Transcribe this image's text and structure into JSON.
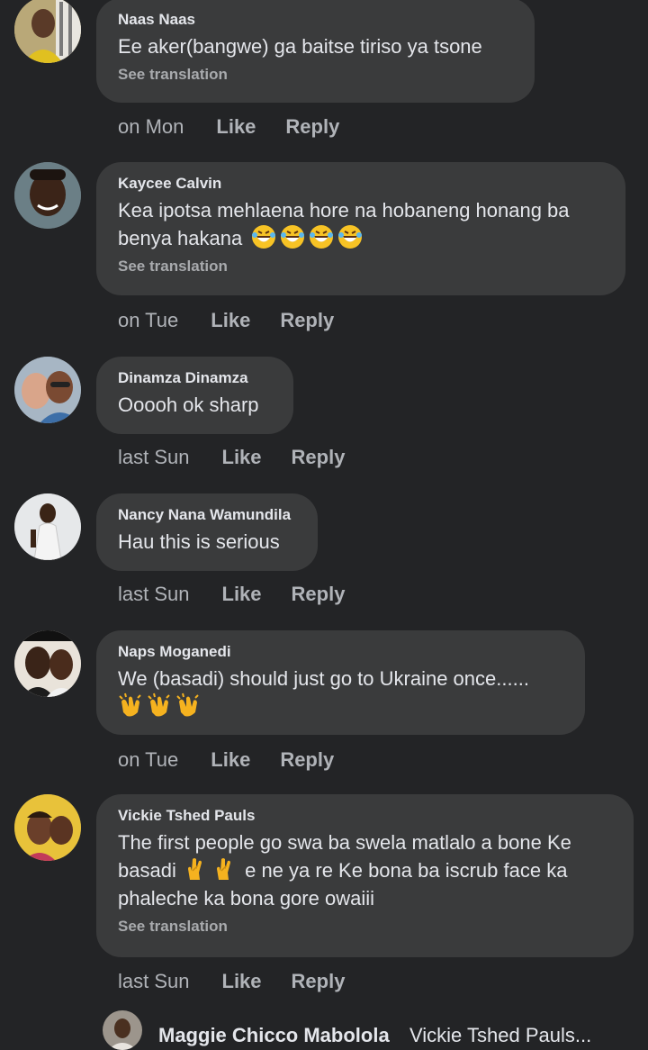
{
  "comments": [
    {
      "author": "Naas Naas",
      "text": "Ee aker(bangwe) ga baitse tiriso ya tsone",
      "see_translation": "See translation",
      "time": "on Mon",
      "like": "Like",
      "reply": "Reply"
    },
    {
      "author": "Kaycee Calvin",
      "text_line1": "Kea ipotsa mehlaena hore na hobaneng honang ba",
      "text_line2": "benya hakana",
      "emoji": "laughing-crying-emoji x4",
      "see_translation": "See translation",
      "time": "on Tue",
      "like": "Like",
      "reply": "Reply"
    },
    {
      "author": "Dinamza Dinamza",
      "text": "Ooooh ok sharp",
      "time": "last Sun",
      "like": "Like",
      "reply": "Reply"
    },
    {
      "author": "Nancy Nana Wamundila",
      "text": "Hau this is serious",
      "time": "last Sun",
      "like": "Like",
      "reply": "Reply"
    },
    {
      "author": "Naps Moganedi",
      "text": "We (basadi) should just go to Ukraine once......",
      "emoji": "clapping-hands-emoji x3",
      "time": "on Tue",
      "like": "Like",
      "reply": "Reply"
    },
    {
      "author": "Vickie Tshed Pauls",
      "text_line1": "The first people go swa ba swela matlalo a bone Ke",
      "text_line2a": "basadi",
      "text_line2b": "e ne ya re Ke bona ba iscrub face ka",
      "text_line3": "phaleche ka bona gore owaiii",
      "emoji": "crossed-fingers-emoji x2",
      "see_translation": "See translation",
      "time": "last Sun",
      "like": "Like",
      "reply": "Reply"
    }
  ],
  "reply_preview": {
    "author": "Maggie Chicco Mabolola",
    "text": "Vickie Tshed Pauls..."
  },
  "colors": {
    "background": "#232426",
    "bubble": "#3a3b3c",
    "text": "#e4e6eb",
    "secondary": "#b0b3b8"
  }
}
